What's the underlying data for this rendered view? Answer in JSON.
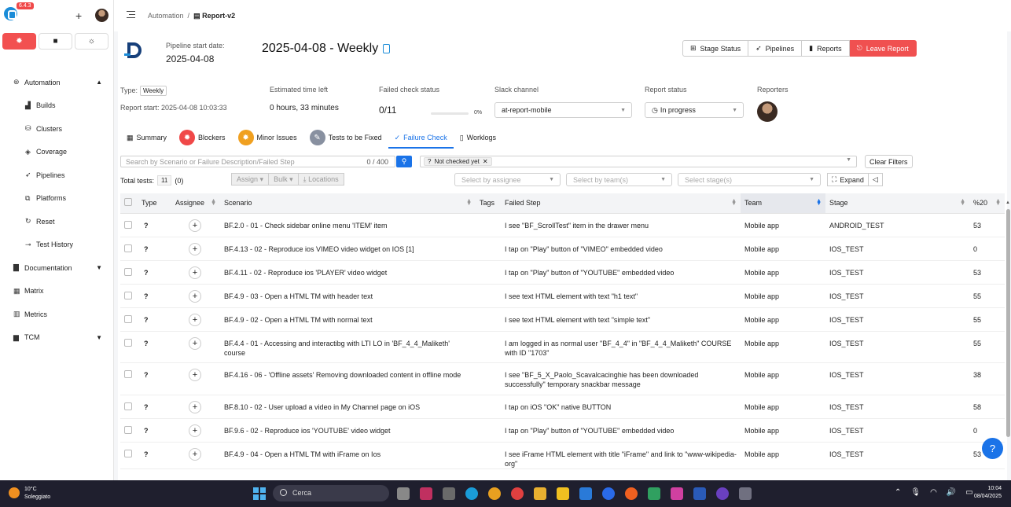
{
  "app": {
    "version": "6.4.3"
  },
  "sidebar": {
    "items": [
      {
        "label": "Automation",
        "icon": "robot-icon",
        "chev": "▲"
      },
      {
        "label": "Builds",
        "icon": "chart-icon",
        "sub": true
      },
      {
        "label": "Clusters",
        "icon": "clusters-icon",
        "sub": true
      },
      {
        "label": "Coverage",
        "icon": "coverage-icon",
        "sub": true
      },
      {
        "label": "Pipelines",
        "icon": "rocket-icon",
        "sub": true
      },
      {
        "label": "Platforms",
        "icon": "platforms-icon",
        "sub": true
      },
      {
        "label": "Reset",
        "icon": "reset-icon",
        "sub": true
      },
      {
        "label": "Test History",
        "icon": "pin-icon",
        "sub": true
      },
      {
        "label": "Documentation",
        "icon": "book-icon",
        "chev": "▼"
      },
      {
        "label": "Matrix",
        "icon": "table-icon"
      },
      {
        "label": "Metrics",
        "icon": "metrics-icon"
      },
      {
        "label": "TCM",
        "icon": "tcm-icon",
        "chev": "▼"
      }
    ]
  },
  "breadcrumb": {
    "parent": "Automation",
    "separator": "/",
    "current": "Report-v2"
  },
  "header": {
    "pipeline_label": "Pipeline start date:",
    "pipeline_date": "2025-04-08",
    "title": "2025-04-08 - Weekly",
    "buttons": {
      "stage_status": "Stage Status",
      "pipelines": "Pipelines",
      "reports": "Reports",
      "leave": "Leave Report"
    }
  },
  "info": {
    "type_label": "Type:",
    "type_value": "Weekly",
    "report_start": "Report start: 2025-04-08 10:03:33",
    "est_label": "Estimated time left",
    "est_value": "0 hours, 33 minutes",
    "failed_label": "Failed check status",
    "failed_value": "0/11",
    "failed_progress": 0,
    "failed_pct": "0%",
    "slack_label": "Slack channel",
    "slack_value": "at-report-mobile",
    "status_label": "Report status",
    "status_value": "In progress",
    "reporters_label": "Reporters"
  },
  "tabs": [
    {
      "label": "Summary"
    },
    {
      "label": "Blockers"
    },
    {
      "label": "Minor Issues"
    },
    {
      "label": "Tests to be Fixed"
    },
    {
      "label": "Failure Check"
    },
    {
      "label": "Worklogs"
    }
  ],
  "filters": {
    "search_placeholder": "Search by Scenario or Failure Description/Failed Step",
    "search_count": "0 / 400",
    "chip": "Not checked yet",
    "chip_prefix": "?",
    "clear": "Clear Filters",
    "total_label": "Total tests:",
    "total_value": "11",
    "selected_value": "(0)",
    "assign": "Assign",
    "bulk": "Bulk",
    "locations": "Locations",
    "assignee_placeholder": "Select by assignee",
    "team_placeholder": "Select by team(s)",
    "stage_placeholder": "Select stage(s)",
    "expand": "Expand"
  },
  "table": {
    "columns": [
      "Type",
      "Assignee",
      "Scenario",
      "Tags",
      "Failed Step",
      "Team",
      "Stage",
      "%20"
    ],
    "rows": [
      {
        "type": "?",
        "scenario": "BF.2.0 - 01 - Check sidebar online menu 'ITEM' item",
        "step": "I see \"BF_ScrollTest\" item in the drawer menu",
        "team": "Mobile app",
        "stage": "ANDROID_TEST",
        "pct": "53"
      },
      {
        "type": "?",
        "scenario": "BF.4.13 - 02 - Reproduce ios VIMEO video widget on IOS [1]",
        "step": "I tap on \"Play\" button of \"VIMEO\" embedded video",
        "team": "Mobile app",
        "stage": "IOS_TEST",
        "pct": "0"
      },
      {
        "type": "?",
        "scenario": "BF.4.11 - 02 - Reproduce ios 'PLAYER' video widget",
        "step": "I tap on \"Play\" button of \"YOUTUBE\" embedded video",
        "team": "Mobile app",
        "stage": "IOS_TEST",
        "pct": "53"
      },
      {
        "type": "?",
        "scenario": "BF.4.9 - 03 - Open a HTML TM with header text",
        "step": "I see text HTML element with text \"h1 text\"",
        "team": "Mobile app",
        "stage": "IOS_TEST",
        "pct": "55"
      },
      {
        "type": "?",
        "scenario": "BF.4.9 - 02 - Open a HTML TM with normal text",
        "step": "I see text HTML element with text \"simple text\"",
        "team": "Mobile app",
        "stage": "IOS_TEST",
        "pct": "55"
      },
      {
        "type": "?",
        "scenario": "BF.4.4 - 01 - Accessing and interactibg with LTI LO in 'BF_4_4_Maliketh' course",
        "step": "I am logged in as normal user \"BF_4_4\" in \"BF_4_4_Maliketh\" COURSE with ID \"1703\"",
        "team": "Mobile app",
        "stage": "IOS_TEST",
        "pct": "55"
      },
      {
        "type": "?",
        "scenario": "BF.4.16 - 06 - 'Offline assets' Removing downloaded content in offline mode",
        "step": "I see \"BF_5_X_Paolo_Scavalcacinghie has been downloaded successfully\" temporary snackbar message",
        "team": "Mobile app",
        "stage": "IOS_TEST",
        "pct": "38"
      },
      {
        "type": "?",
        "scenario": "BF.8.10 - 02 - User upload a video in My Channel page on iOS",
        "step": "I tap on iOS \"OK\" native BUTTON",
        "team": "Mobile app",
        "stage": "IOS_TEST",
        "pct": "58"
      },
      {
        "type": "?",
        "scenario": "BF.9.6 - 02 - Reproduce ios 'YOUTUBE' video widget",
        "step": "I tap on \"Play\" button of \"YOUTUBE\" embedded video",
        "team": "Mobile app",
        "stage": "IOS_TEST",
        "pct": "0"
      },
      {
        "type": "?",
        "scenario": "BF.4.9 - 04 - Open a HTML TM with iFrame on Ios",
        "step": "I see iFrame HTML element with title \"iFrame\" and link to \"www-wikipedia-org\"",
        "team": "Mobile app",
        "stage": "IOS_TEST",
        "pct": "53"
      }
    ]
  },
  "taskbar": {
    "temp": "10°C",
    "weather": "Soleggiato",
    "search": "Cerca",
    "time": "10:04",
    "date": "08/04/2025"
  },
  "colors": {
    "accent": "#1a73e8",
    "danger": "#f05050",
    "blocker": "#f04848",
    "minor": "#f0a020",
    "fixed": "#8890a0"
  }
}
